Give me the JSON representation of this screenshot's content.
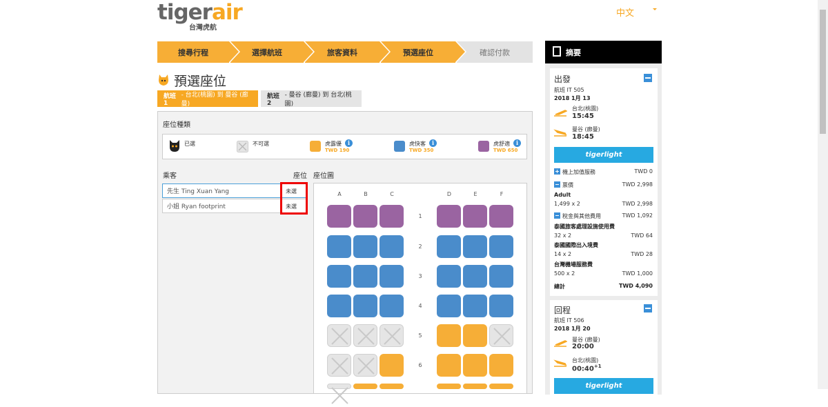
{
  "header": {
    "logo_word_a": "tiger",
    "logo_word_b": "air",
    "logo_sub": "台灣虎航",
    "language": "中文"
  },
  "steps": [
    "搜尋行程",
    "選擇航班",
    "旅客資料",
    "預選座位",
    "確認付款"
  ],
  "page_title": "預選座位",
  "flight_tabs": [
    {
      "label_bold": "航班 1",
      "label_rest": " - 台北(桃園) 到 曼谷 (廊曼)"
    },
    {
      "label_bold": "航班 2",
      "label_rest": " - 曼谷 (廊曼) 到 台北(桃園)"
    }
  ],
  "seat_type_title": "座位種類",
  "legend": {
    "selected": "已選",
    "unavailable": "不可選",
    "items": [
      {
        "name": "虎露優",
        "price": "TWD 190",
        "color": "#f6ae37"
      },
      {
        "name": "虎快客",
        "price": "TWD 350",
        "color": "#4a8ccb"
      },
      {
        "name": "虎舒適",
        "price": "TWD 650",
        "color": "#9a64a1"
      }
    ]
  },
  "passengers_header": "乘客",
  "seat_header": "座位",
  "seatmap_header": "座位圖",
  "passengers": [
    {
      "name": "先生 Ting Xuan Yang",
      "seat": "未選"
    },
    {
      "name": "小姐 Ryan footprint",
      "seat": "未選"
    }
  ],
  "seatmap": {
    "columns": [
      "A",
      "B",
      "C",
      "D",
      "E",
      "F"
    ],
    "rows": [
      {
        "num": "1",
        "seats": [
          "p",
          "p",
          "p",
          "p",
          "p",
          "p"
        ]
      },
      {
        "num": "2",
        "seats": [
          "b",
          "b",
          "b",
          "b",
          "b",
          "b"
        ]
      },
      {
        "num": "3",
        "seats": [
          "b",
          "b",
          "b",
          "b",
          "b",
          "b"
        ]
      },
      {
        "num": "4",
        "seats": [
          "b",
          "b",
          "b",
          "b",
          "b",
          "b"
        ]
      },
      {
        "num": "5",
        "seats": [
          "x",
          "x",
          "x",
          "o",
          "o",
          "x"
        ]
      },
      {
        "num": "6",
        "seats": [
          "x",
          "x",
          "o",
          "o",
          "o",
          "o"
        ]
      },
      {
        "num": "",
        "seats": [
          "x",
          "o",
          "o",
          "o",
          "o",
          "o"
        ]
      }
    ]
  },
  "summary": {
    "title": "摘要",
    "outbound": {
      "title": "出發",
      "flight": "航班 IT 505",
      "date": "2018 1月 13",
      "from": "台北(桃園)",
      "dep_time": "15:45",
      "to": "曼谷 (廊曼)",
      "arr_time": "18:45",
      "fare": "tigerlight"
    },
    "lines": {
      "addon": "機上加值服務",
      "addon_val": "TWD 0",
      "fare": "票價",
      "fare_val": "TWD 2,998",
      "adult": "Adult",
      "adult_calc": "1,499 x 2",
      "adult_val": "TWD 2,998",
      "tax": "稅金與其他費用",
      "tax_val": "TWD 1,092",
      "t1": "泰國旅客處理設施使用費",
      "t1_calc": "32 x 2",
      "t1_val": "TWD 64",
      "t2": "泰國國際出入境費",
      "t2_calc": "14 x 2",
      "t2_val": "TWD 28",
      "t3": "台灣機場服務費",
      "t3_calc": "500 x 2",
      "t3_val": "TWD 1,000",
      "total": "總計",
      "total_val": "TWD 4,090"
    },
    "return": {
      "title": "回程",
      "flight": "航班 IT 506",
      "date": "2018 1月 20",
      "from": "曼谷 (廊曼)",
      "dep_time": "20:00",
      "to": "台北(桃園)",
      "arr_time": "00:40",
      "arr_sup": "+1",
      "fare": "tigerlight"
    }
  }
}
